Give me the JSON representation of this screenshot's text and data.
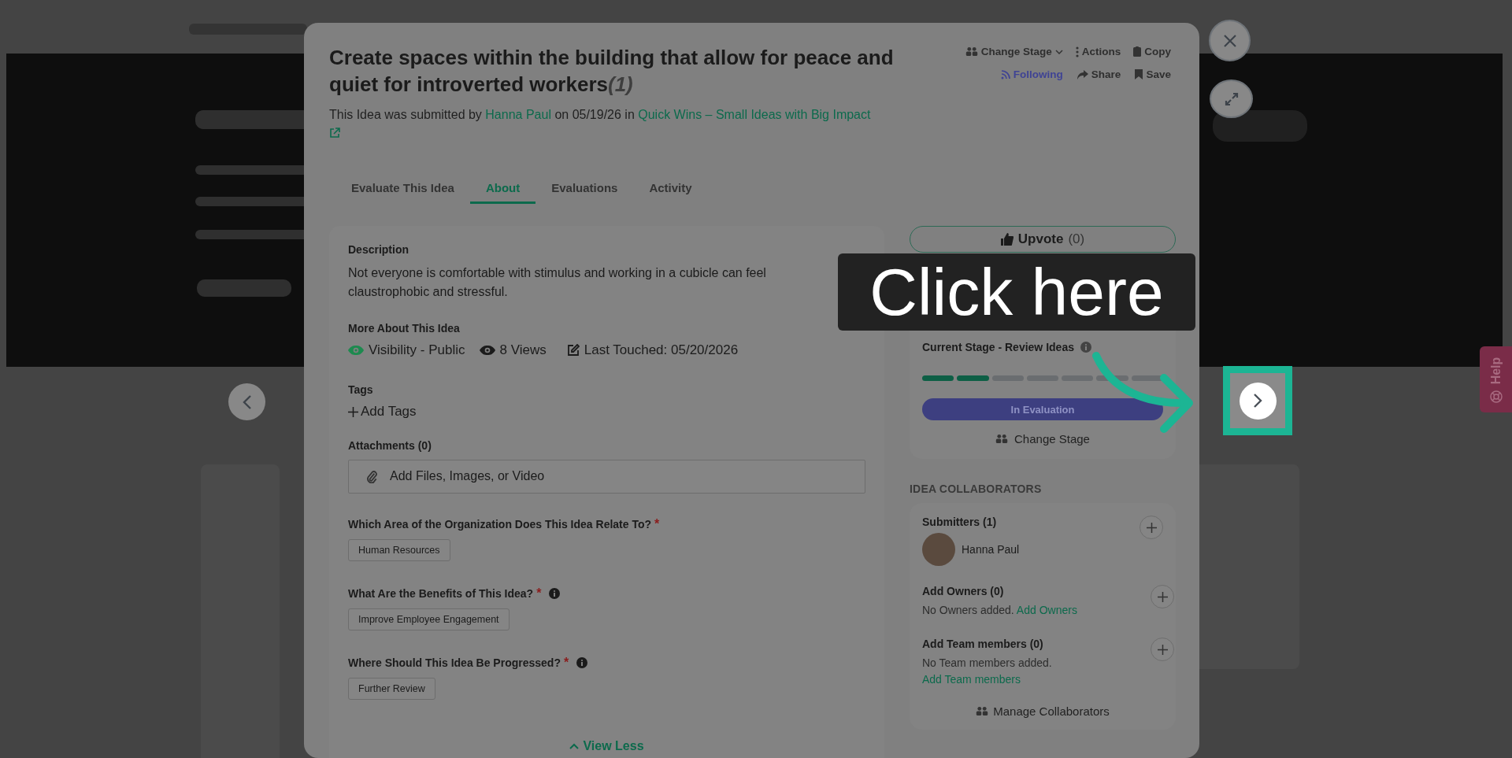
{
  "header": {
    "title": "Create spaces within the building that allow for peace and quiet for introverted workers",
    "title_count": "(1)",
    "actions": [
      {
        "kind": "stage",
        "label": "Change Stage"
      },
      {
        "kind": "menu",
        "label": "Actions"
      },
      {
        "kind": "copy",
        "label": "Copy"
      },
      {
        "kind": "follow",
        "label": "Following"
      },
      {
        "kind": "share",
        "label": "Share"
      },
      {
        "kind": "save",
        "label": "Save"
      }
    ],
    "submitted": {
      "prefix": "This Idea was submitted by",
      "author": "Hanna Paul",
      "middle": "on 05/19/26 in",
      "campaign": "Quick Wins – Small Ideas with Big Impact"
    }
  },
  "tabs": [
    {
      "label": "Evaluate This Idea",
      "selected": false
    },
    {
      "label": "About",
      "selected": true
    },
    {
      "label": "Evaluations",
      "selected": false
    },
    {
      "label": "Activity",
      "selected": false
    }
  ],
  "details": {
    "description_label": "Description",
    "description": "Not everyone is comfortable with stimulus and working in a cubicle can feel claustrophobic and stressful.",
    "more_label": "More About This Idea",
    "visibility": "Visibility - Public",
    "views": "8 Views",
    "last_touched": "Last Touched: 05/20/2026",
    "tags_label": "Tags",
    "add_tags": "Add Tags",
    "attachments_label": "Attachments (0)",
    "attach_button": "Add Files, Images, or Video",
    "questions": [
      {
        "label": "Which Area of the Organization Does This Idea Relate To?",
        "required_mark": "*",
        "info": false,
        "answer": "Human Resources"
      },
      {
        "label": "What Are the Benefits of This Idea?",
        "required_mark": "*",
        "info": true,
        "answer": "Improve Employee Engagement"
      },
      {
        "label": "Where Should This Idea Be Progressed?",
        "required_mark": "*",
        "info": true,
        "answer": "Further Review"
      }
    ],
    "view_less": "View Less"
  },
  "sidebar": {
    "upvote": {
      "label": "Upvote",
      "count": "(0)"
    },
    "progress": {
      "current_stage": "Current Stage - Review Ideas",
      "segments": [
        {
          "done": true
        },
        {
          "done": true
        },
        {
          "done": false
        },
        {
          "done": false
        },
        {
          "done": false
        },
        {
          "done": false
        },
        {
          "done": false
        }
      ],
      "status": "In Evaluation",
      "change_stage": "Change Stage"
    },
    "collaborators_heading": "IDEA COLLABORATORS",
    "groups": [
      {
        "kind": "members",
        "title": "Submitters (1)",
        "members": [
          {
            "name": "Hanna Paul"
          }
        ]
      },
      {
        "kind": "empty",
        "title": "Add Owners (0)",
        "empty_text": "No Owners added.",
        "add_link": "Add Owners"
      },
      {
        "kind": "empty",
        "title": "Add Team members (0)",
        "empty_text": "No Team members added.",
        "add_link": "Add Team members"
      }
    ],
    "manage": "Manage Collaborators"
  },
  "tour": {
    "callout": "Click here"
  },
  "help": {
    "label": "Help"
  }
}
